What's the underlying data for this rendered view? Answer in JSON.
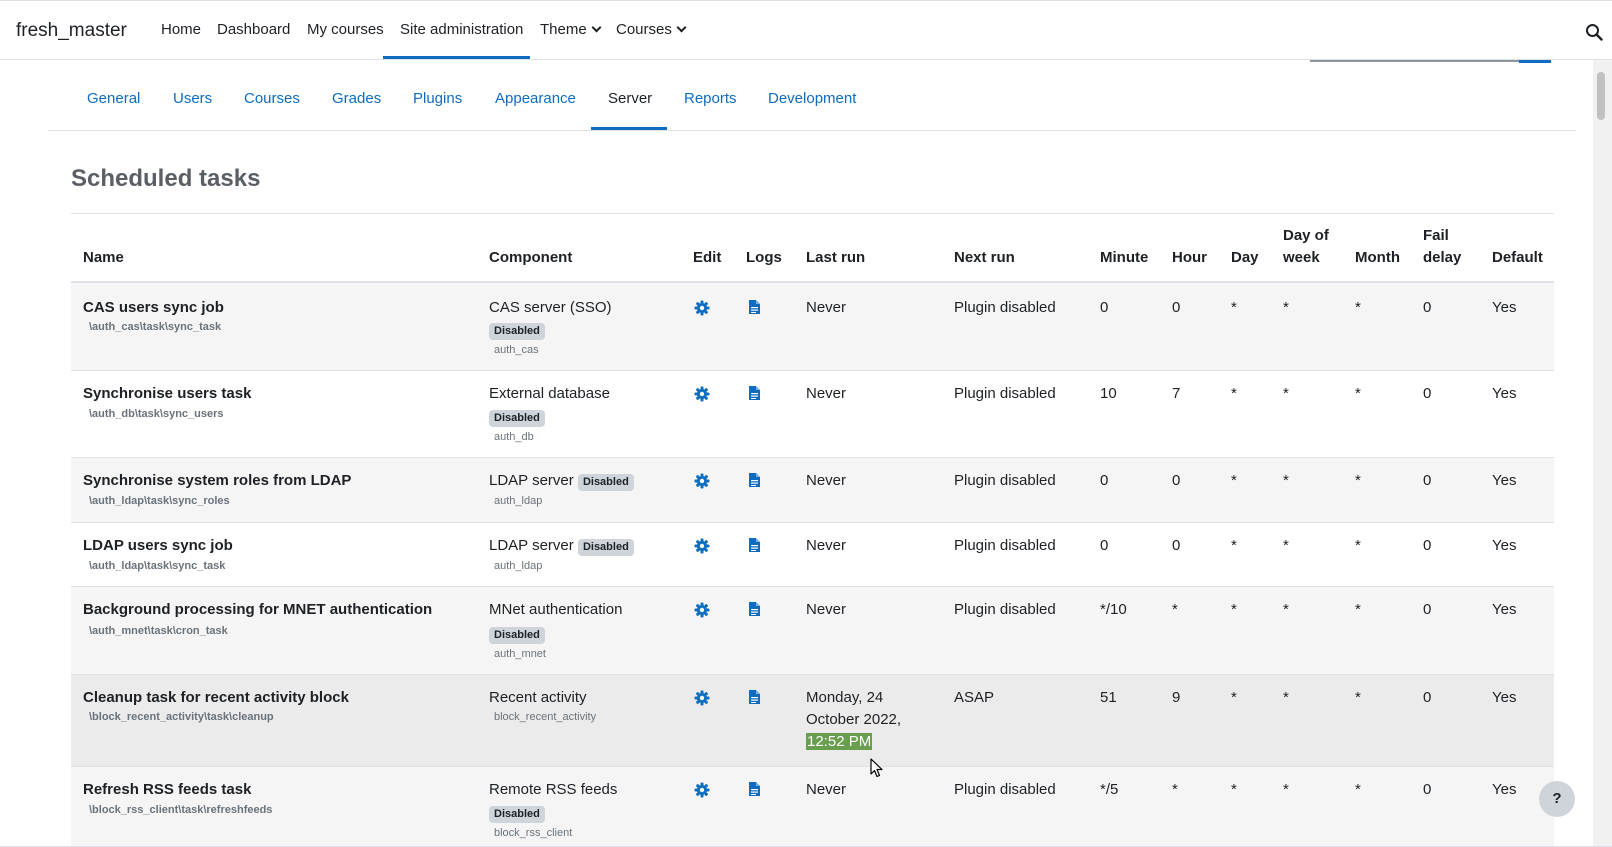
{
  "navbar": {
    "brand": "fresh_master",
    "items": [
      {
        "label": "Home"
      },
      {
        "label": "Dashboard"
      },
      {
        "label": "My courses"
      },
      {
        "label": "Site administration"
      },
      {
        "label": "Theme"
      },
      {
        "label": "Courses"
      }
    ],
    "search_icon": "search-icon"
  },
  "tabs": [
    {
      "label": "General"
    },
    {
      "label": "Users"
    },
    {
      "label": "Courses"
    },
    {
      "label": "Grades"
    },
    {
      "label": "Plugins"
    },
    {
      "label": "Appearance"
    },
    {
      "label": "Server",
      "active": true
    },
    {
      "label": "Reports"
    },
    {
      "label": "Development"
    }
  ],
  "page": {
    "title": "Scheduled tasks"
  },
  "table": {
    "headers": {
      "name": "Name",
      "component": "Component",
      "edit": "Edit",
      "logs": "Logs",
      "last_run": "Last run",
      "next_run": "Next run",
      "minute": "Minute",
      "hour": "Hour",
      "day": "Day",
      "dow_1": "Day of",
      "dow_2": "week",
      "month": "Month",
      "fail_1": "Fail",
      "fail_2": "delay",
      "default": "Default"
    },
    "disabled_badge": "Disabled",
    "rows": [
      {
        "name": "CAS users sync job",
        "classname": "\\auth_cas\\task\\sync_task",
        "component": "CAS server (SSO)",
        "code": "auth_cas",
        "last_run": "Never",
        "next_run": "Plugin disabled",
        "minute": "0",
        "hour": "0",
        "day": "*",
        "dow": "*",
        "month": "*",
        "fail": "0",
        "default": "Yes"
      },
      {
        "name": "Synchronise users task",
        "classname": "\\auth_db\\task\\sync_users",
        "component": "External database",
        "code": "auth_db",
        "last_run": "Never",
        "next_run": "Plugin disabled",
        "minute": "10",
        "hour": "7",
        "day": "*",
        "dow": "*",
        "month": "*",
        "fail": "0",
        "default": "Yes"
      },
      {
        "name": "Synchronise system roles from LDAP",
        "classname": "\\auth_ldap\\task\\sync_roles",
        "component": "LDAP server",
        "code": "auth_ldap",
        "last_run": "Never",
        "next_run": "Plugin disabled",
        "minute": "0",
        "hour": "0",
        "day": "*",
        "dow": "*",
        "month": "*",
        "fail": "0",
        "default": "Yes"
      },
      {
        "name": "LDAP users sync job",
        "classname": "\\auth_ldap\\task\\sync_task",
        "component": "LDAP server",
        "code": "auth_ldap",
        "last_run": "Never",
        "next_run": "Plugin disabled",
        "minute": "0",
        "hour": "0",
        "day": "*",
        "dow": "*",
        "month": "*",
        "fail": "0",
        "default": "Yes"
      },
      {
        "name": "Background processing for MNET authentication",
        "classname": "\\auth_mnet\\task\\cron_task",
        "component": "MNet authentication",
        "code": "auth_mnet",
        "last_run": "Never",
        "next_run": "Plugin disabled",
        "minute": "*/10",
        "hour": "*",
        "day": "*",
        "dow": "*",
        "month": "*",
        "fail": "0",
        "default": "Yes"
      },
      {
        "name": "Cleanup task for recent activity block",
        "classname": "\\block_recent_activity\\task\\cleanup",
        "component": "Recent activity",
        "code": "block_recent_activity",
        "last_run_1": "Monday, 24",
        "last_run_2": "October 2022,",
        "last_run_3": "12:52 PM",
        "next_run": "ASAP",
        "minute": "51",
        "hour": "9",
        "day": "*",
        "dow": "*",
        "month": "*",
        "fail": "0",
        "default": "Yes"
      },
      {
        "name": "Refresh RSS feeds task",
        "classname": "\\block_rss_client\\task\\refreshfeeds",
        "component": "Remote RSS feeds",
        "code": "block_rss_client",
        "last_run": "Never",
        "next_run": "Plugin disabled",
        "minute": "*/5",
        "hour": "*",
        "day": "*",
        "dow": "*",
        "month": "*",
        "fail": "0",
        "default": "Yes"
      }
    ]
  },
  "help_button": {
    "label": "?"
  },
  "colors": {
    "accent": "#0f6cbf",
    "highlight": "#6a9e4f",
    "badge": "#ced4da"
  }
}
